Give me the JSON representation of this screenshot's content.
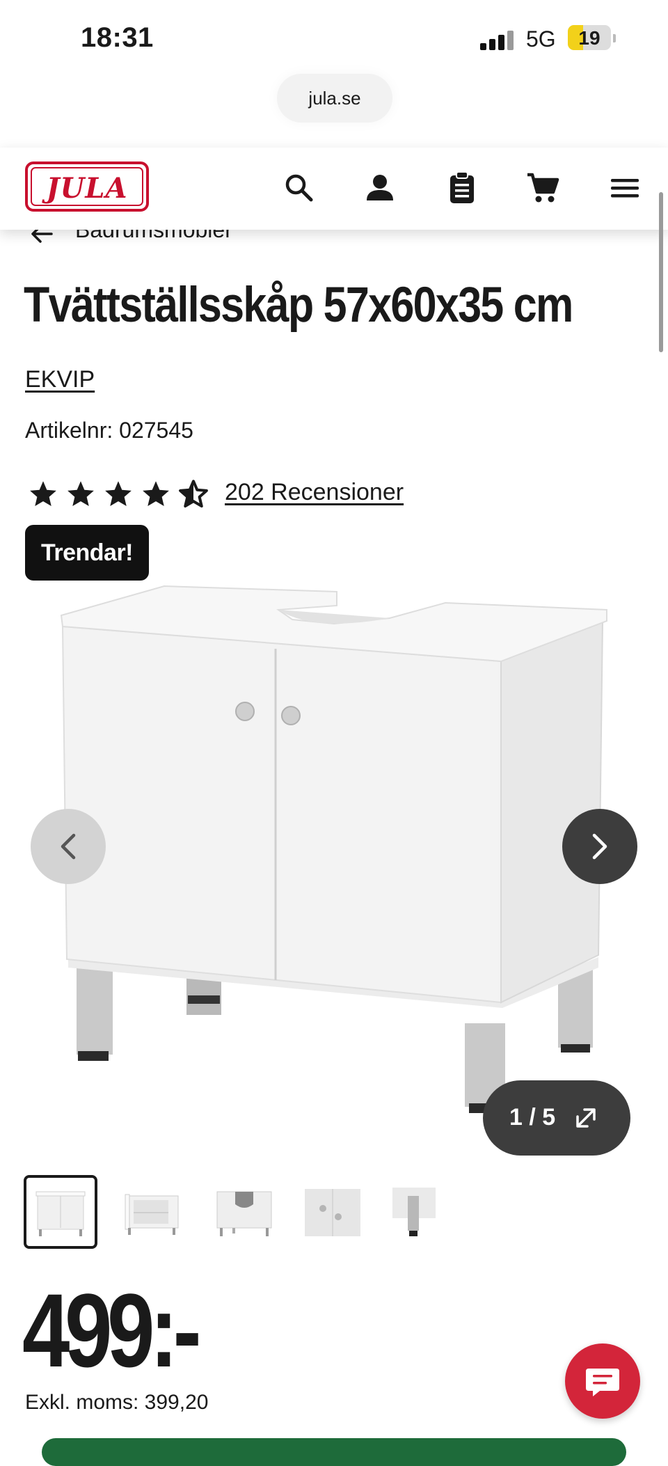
{
  "status_bar": {
    "time": "18:31",
    "network": "5G",
    "battery": "19"
  },
  "browser": {
    "url": "jula.se"
  },
  "header": {
    "logo_text": "JULA",
    "brand_color": "#c8102e"
  },
  "breadcrumb": {
    "label": "Badrumsmöbler"
  },
  "product": {
    "title": "Tvättställsskåp 57x60x35 cm",
    "brand": "EKVIP",
    "article": "Artikelnr: 027545",
    "rating": 4.5,
    "reviews": "202 Recensioner",
    "badge": "Trendar!"
  },
  "gallery": {
    "counter": "1 / 5",
    "thumbnails": [
      "cabinet-front",
      "cabinet-open",
      "cabinet-back",
      "knob-detail",
      "leg-detail"
    ]
  },
  "price": {
    "amount": "499:-",
    "ex_vat": "Exkl. moms: 399,20"
  },
  "colors": {
    "accent_red": "#d3253a",
    "dark": "#3d3d3d",
    "green": "#1e6b3a"
  }
}
